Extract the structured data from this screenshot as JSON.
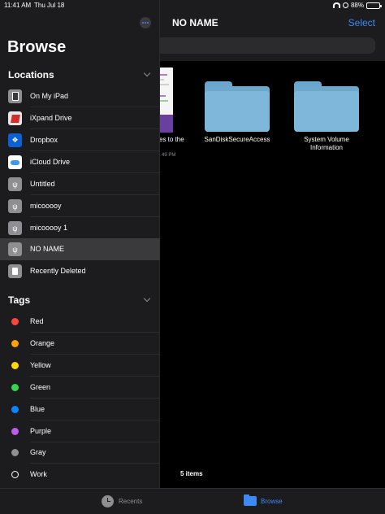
{
  "status": {
    "time": "11:41 AM",
    "date": "Thu Jul 18",
    "battery": "88%",
    "battery_level": 0.88
  },
  "main": {
    "title": "NO NAME",
    "select_label": "Select",
    "files": [
      {
        "label": "es to the",
        "sub": "49 PM"
      },
      {
        "label": "SanDiskSecureAccess"
      },
      {
        "label": "System Volume\nInformation"
      }
    ],
    "items_count": "5 items"
  },
  "sidebar": {
    "title": "Browse",
    "locations_header": "Locations",
    "locations": [
      {
        "label": "On My iPad",
        "icon": "ipad-icon"
      },
      {
        "label": "iXpand Drive",
        "icon": "ixpand-icon"
      },
      {
        "label": "Dropbox",
        "icon": "dropbox-icon"
      },
      {
        "label": "iCloud Drive",
        "icon": "icloud-icon"
      },
      {
        "label": "Untitled",
        "icon": "usb-icon"
      },
      {
        "label": "micooooy",
        "icon": "usb-icon"
      },
      {
        "label": "micooooy 1",
        "icon": "usb-icon"
      },
      {
        "label": "NO NAME",
        "icon": "usb-icon",
        "selected": true
      },
      {
        "label": "Recently Deleted",
        "icon": "trash-icon"
      }
    ],
    "tags_header": "Tags",
    "tags": [
      {
        "label": "Red",
        "color": "#ff453a"
      },
      {
        "label": "Orange",
        "color": "#ff9f0a"
      },
      {
        "label": "Yellow",
        "color": "#ffd60a"
      },
      {
        "label": "Green",
        "color": "#32d74b"
      },
      {
        "label": "Blue",
        "color": "#0a84ff"
      },
      {
        "label": "Purple",
        "color": "#bf5af2"
      },
      {
        "label": "Gray",
        "color": "#8e8e93"
      },
      {
        "label": "Work",
        "color": "hollow"
      }
    ]
  },
  "tabbar": {
    "recents": "Recents",
    "browse": "Browse"
  },
  "colors": {
    "accent": "#3d8af7",
    "sidebar_bg": "#1c1c1e",
    "selected_row": "#3a3a3c"
  }
}
